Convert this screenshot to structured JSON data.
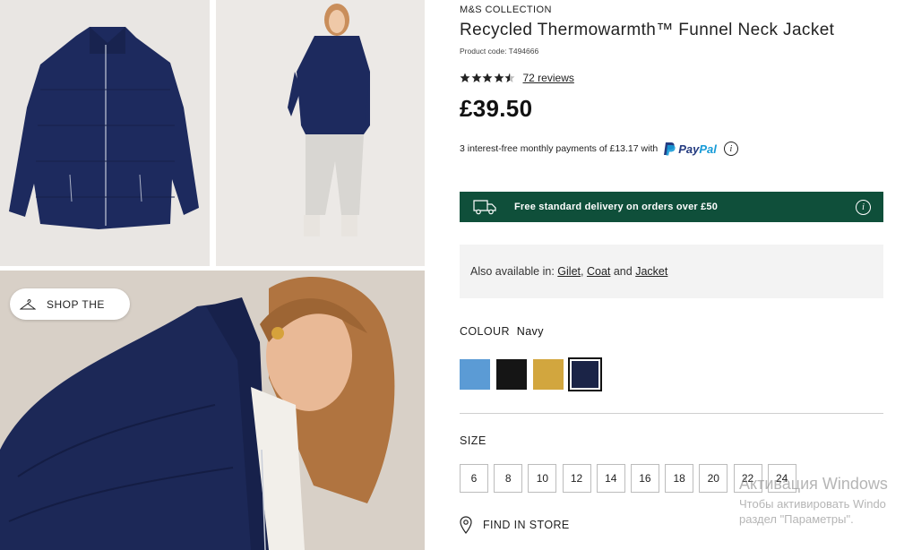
{
  "brand": "M&S COLLECTION",
  "title": "Recycled Thermowarmth™ Funnel Neck Jacket",
  "product_code": "Product code: T494666",
  "rating": {
    "stars": 4.5,
    "max": 5,
    "reviews_label": "72 reviews"
  },
  "price": "£39.50",
  "installments": {
    "text": "3 interest-free monthly payments of £13.17 with",
    "provider_a": "Pay",
    "provider_b": "Pal",
    "info_icon": "info-icon"
  },
  "delivery": {
    "text": "Free standard delivery on orders over £50",
    "icon": "truck-icon",
    "color": "#0f4f3a"
  },
  "also_available": {
    "prefix": "Also available in:",
    "items": [
      "Gilet",
      "Coat",
      "Jacket"
    ],
    "sep_comma": ",",
    "sep_and": "and"
  },
  "colour": {
    "label": "COLOUR",
    "selected": "Navy",
    "swatches": [
      {
        "name": "light-blue",
        "color": "#5b9bd5"
      },
      {
        "name": "black",
        "color": "#151515"
      },
      {
        "name": "ochre",
        "color": "#d2a63e"
      },
      {
        "name": "navy",
        "color": "#1b2447",
        "selected": true
      }
    ]
  },
  "size": {
    "label": "SIZE",
    "options": [
      "6",
      "8",
      "10",
      "12",
      "14",
      "16",
      "18",
      "20",
      "22",
      "24"
    ]
  },
  "find_in_store": "FIND IN STORE",
  "shop_the": "SHOP THE",
  "watermark": {
    "line1": "Активация Windows",
    "line2": "Чтобы активировать Windo",
    "line3": "раздел \"Параметры\"."
  }
}
